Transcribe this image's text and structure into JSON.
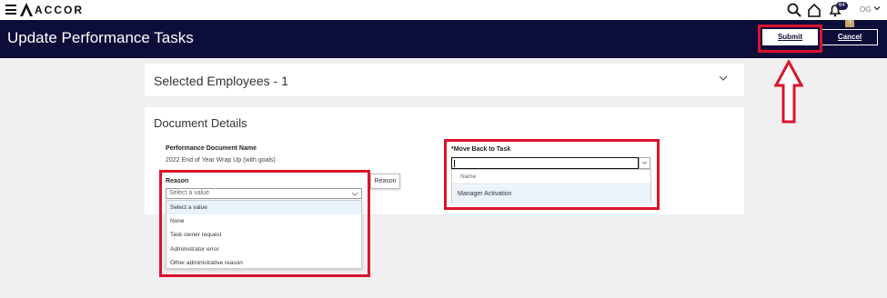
{
  "topbar": {
    "brand": "ACCOR",
    "icons": [
      "menu-icon",
      "search-icon",
      "home-icon",
      "bell-icon"
    ],
    "notification_count": "64",
    "user_initials": "OG"
  },
  "header": {
    "title": "Update Performance Tasks",
    "submit_label": "Submit",
    "cancel_label": "Cancel",
    "help_tag": "?"
  },
  "employees_card": {
    "title": "Selected Employees - 1"
  },
  "document_card": {
    "title": "Document Details",
    "doc_name_label": "Performance Document Name",
    "doc_name_value": "2022 End of Year Wrap Up (with goals)",
    "reason_label": "Reason",
    "reason_placeholder": "Select a value",
    "reason_button": "Reason",
    "reason_options": [
      "Select a value",
      "None",
      "Task owner request",
      "Administrator error",
      "Other administrative reason"
    ],
    "reason_selected_index": 0,
    "move_back_label": "*Move Back to Task",
    "move_back_value": "",
    "move_back_column_header": "Name",
    "move_back_options": [
      "Manager Activation"
    ]
  },
  "colors": {
    "header_bg": "#0d0d3a",
    "highlight": "#d9142b",
    "page_bg": "#f0f0f0",
    "selected_option_bg": "#eaf3fa"
  }
}
